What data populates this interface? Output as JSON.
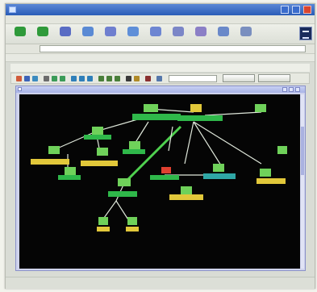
{
  "browser": {
    "title": "",
    "menu": [
      "",
      "",
      "",
      "",
      "",
      ""
    ],
    "toolbar": {
      "buttons": [
        {
          "icon": "back-icon",
          "color": "#2f9a3a",
          "label": ""
        },
        {
          "icon": "forward-icon",
          "color": "#2f9a3a",
          "label": ""
        },
        {
          "icon": "stop-icon",
          "color": "#5a6dc4",
          "label": ""
        },
        {
          "icon": "refresh-icon",
          "color": "#5a8ad4",
          "label": ""
        },
        {
          "icon": "home-icon",
          "color": "#6f7fcf",
          "label": ""
        },
        {
          "icon": "search-icon",
          "color": "#5f8fd8",
          "label": ""
        },
        {
          "icon": "favorites-icon",
          "color": "#6d86d2",
          "label": ""
        },
        {
          "icon": "media-icon",
          "color": "#7b86c7",
          "label": ""
        },
        {
          "icon": "history-icon",
          "color": "#8b7fc6",
          "label": ""
        },
        {
          "icon": "mail-icon",
          "color": "#6a89c9",
          "label": ""
        },
        {
          "icon": "print-icon",
          "color": "#7a8fbf",
          "label": ""
        }
      ]
    },
    "address": {
      "label": "",
      "value": ""
    },
    "links": [
      "",
      "",
      "",
      ""
    ],
    "status": {
      "left": "",
      "right": ""
    }
  },
  "app": {
    "menu": [
      "",
      "",
      "",
      "",
      "",
      "",
      "",
      "",
      "",
      ""
    ],
    "toolbar": {
      "search_placeholder": "",
      "btn_1": "",
      "btn_2": ""
    },
    "map_window": {
      "title": ""
    }
  },
  "colors": {
    "canvas_bg": "#050505",
    "node_green": "#2fb84a",
    "node_lightgreen": "#6fd15a",
    "node_yellow": "#e2c83a",
    "node_cyan": "#2fa7a6",
    "node_red": "#e04030",
    "link": "#dfe7da"
  }
}
